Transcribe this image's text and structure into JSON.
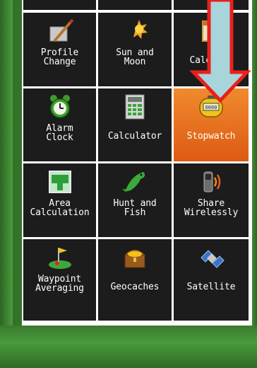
{
  "menu": {
    "tiles": [
      {
        "label": "Profile\nChange",
        "icon": "profile-change-icon"
      },
      {
        "label": "Sun and\nMoon",
        "icon": "sun-moon-icon"
      },
      {
        "label": "Calendar",
        "icon": "calendar-icon"
      },
      {
        "label": "Alarm\nClock",
        "icon": "alarm-clock-icon"
      },
      {
        "label": "Calculator",
        "icon": "calculator-icon"
      },
      {
        "label": "Stopwatch",
        "icon": "stopwatch-icon",
        "selected": true
      },
      {
        "label": "Area\nCalculation",
        "icon": "area-calculation-icon"
      },
      {
        "label": "Hunt and\nFish",
        "icon": "hunt-fish-icon"
      },
      {
        "label": "Share\nWirelessly",
        "icon": "share-wirelessly-icon"
      },
      {
        "label": "Waypoint\nAveraging",
        "icon": "waypoint-averaging-icon"
      },
      {
        "label": "Geocaches",
        "icon": "geocaches-icon"
      },
      {
        "label": "Satellite",
        "icon": "satellite-icon"
      }
    ]
  },
  "colors": {
    "tile_bg": "#1c1c1c",
    "selected_bg": "#e06518",
    "arrow_fill": "#a8d4dc",
    "arrow_outline": "#e8201c",
    "frame_green": "#4a9a3c"
  }
}
